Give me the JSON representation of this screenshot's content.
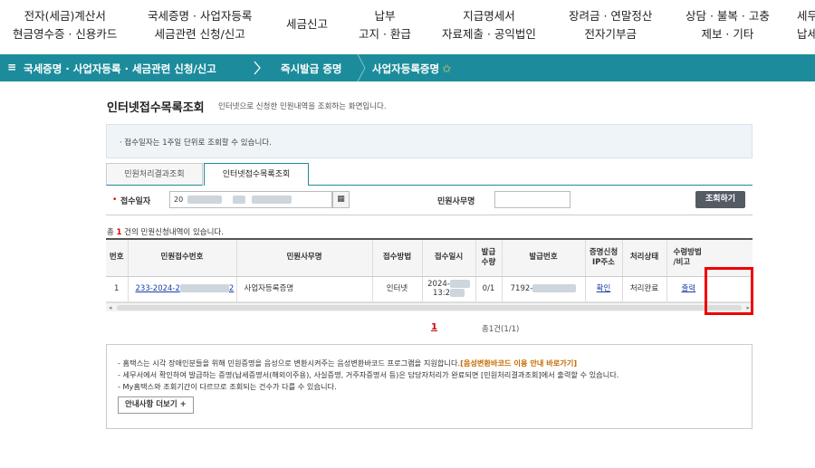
{
  "topnav": [
    {
      "l1": "전자(세금)계산서",
      "l2": "현금영수증 · 신용카드"
    },
    {
      "l1": "국세증명 · 사업자등록",
      "l2": "세금관련 신청/신고"
    },
    {
      "l1": "세금신고",
      "l2": ""
    },
    {
      "l1": "납부",
      "l2": "고지 · 환급"
    },
    {
      "l1": "지급명세서",
      "l2": "자료제출 · 공익법인"
    },
    {
      "l1": "장려금 · 연말정산",
      "l2": "전자기부금"
    },
    {
      "l1": "상담 · 불복 · 고충",
      "l2": "제보 · 기타"
    },
    {
      "l1": "세무",
      "l2": "납세"
    }
  ],
  "breadcrumb": {
    "menu_glyph": "≡",
    "item1": "국세증명 · 사업자등록 · 세금관련 신청/신고",
    "item2": "즉시발급 증명",
    "item3": "사업자등록증명",
    "star": "✩"
  },
  "page": {
    "title": "인터넷접수목록조회",
    "desc": "인터넷으로 신청한 민원내역을 조회하는 화면입니다.",
    "info": "· 접수일자는 1주일 단위로 조회할 수 있습니다."
  },
  "tabs": {
    "tab1": "민원처리결과조회",
    "tab2": "인터넷접수목록조회"
  },
  "search": {
    "req": "•",
    "date_label": "접수일자",
    "date_prefix": "20",
    "cal_glyph": "▦",
    "office_label": "민원사무명",
    "button": "조회하기"
  },
  "count": {
    "pre": "총 ",
    "num": "1",
    "post": " 건의 민원신청내역이 있습니다."
  },
  "table": {
    "headers": [
      "번호",
      "민원접수번호",
      "민원사무명",
      "접수방법",
      "접수일시",
      "발급\n수량",
      "발급번호",
      "증명신청\nIP주소",
      "처리상태",
      "수령방법\n/비고"
    ],
    "row": {
      "no": "1",
      "receipt_prefix": "233-2024-2",
      "receipt_suffix": "2",
      "office": "사업자등록증명",
      "method": "인터넷",
      "date_prefix": "2024-",
      "time_prefix": "13:2",
      "qty": "0/1",
      "issue_prefix": "7192-",
      "ip": "확인",
      "status": "처리완료",
      "receive": "출력"
    },
    "scroll_left": "◂",
    "scroll_right": "▸"
  },
  "pagination": {
    "current": "1",
    "total": "총1건(1/1)"
  },
  "notice": {
    "line1_pre": "- 홈택스는 시각 장애인분들을 위해 민원증명을 음성으로 변환시켜주는 음성변환바코드 프로그램을 지원합니다.",
    "line1_hl": "[음성변환바코드 이용 안내 바로가기]",
    "line2": "- 세무서에서 확인하여 발급하는 증명(납세증명서(해외이주용), 사실증명, 거주자증명서 등)은 담당자처리가 완료되면 [민원처리결과조회]에서 출력할 수 있습니다.",
    "line3": "- My홈택스와 조회기간이 다르므로 조회되는 건수가 다를 수 있습니다.",
    "more": "안내사항 더보기 +"
  }
}
